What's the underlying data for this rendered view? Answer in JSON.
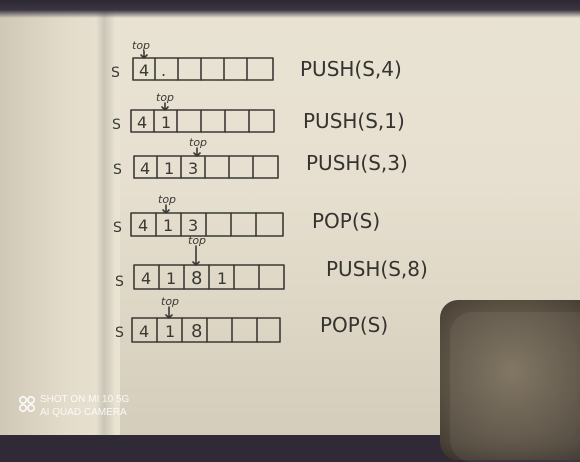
{
  "watermark": {
    "line1": "SHOT ON MI 10 5G",
    "line2": "AI QUAD CAMERA"
  },
  "notes": {
    "stack_label": "S",
    "pointer_label": "top",
    "rows": [
      {
        "cells": [
          "4",
          ".",
          "",
          "",
          "",
          ""
        ],
        "command": "PUSH(S,4)"
      },
      {
        "cells": [
          "4",
          "1",
          "",
          "",
          "",
          ""
        ],
        "command": "PUSH(S,1)"
      },
      {
        "cells": [
          "4",
          "1",
          "3",
          "",
          "",
          ""
        ],
        "command": "PUSH(S,3)"
      },
      {
        "cells": [
          "4",
          "1",
          "3",
          "",
          "",
          ""
        ],
        "command": "POP(S)"
      },
      {
        "cells": [
          "4",
          "1",
          "8",
          "1",
          "",
          ""
        ],
        "command": "PUSH(S,8)"
      },
      {
        "cells": [
          "4",
          "1",
          "8",
          "",
          "",
          ""
        ],
        "command": "POP(S)"
      }
    ]
  }
}
